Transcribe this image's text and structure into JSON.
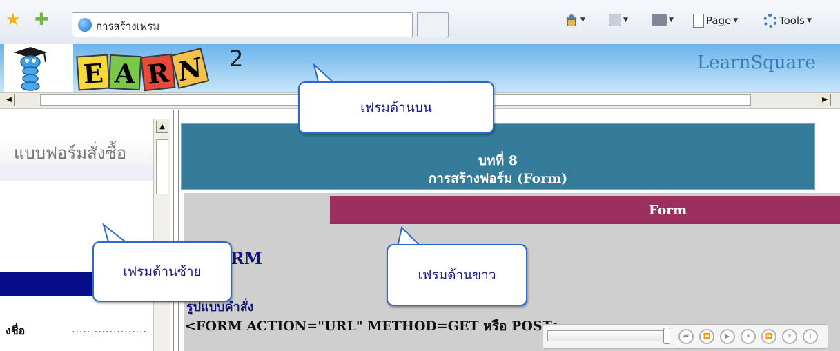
{
  "browser": {
    "tab_title": "การสร้างเฟรม",
    "toolbar": {
      "page_label": "Page",
      "tools_label": "Tools",
      "caret": "▼"
    }
  },
  "banner": {
    "logo_letters": [
      "E",
      "A",
      "R",
      "N"
    ],
    "logo_superscript": "2",
    "site_name": "LearnSquare"
  },
  "left_frame": {
    "title": "แบบฟอร์มสั่งซื้อ",
    "field_label": "งชื่อ",
    "field_placeholder": "...................."
  },
  "right_frame": {
    "chapter_number": "บทที่ 8",
    "chapter_title": "การสร้างฟอร์ม (Form)",
    "form_bar": "Form",
    "heading": "n  FORM",
    "syntax_label": "รูปแบบคำสั่ง",
    "code": "<FORM ACTION=\"URL\" METHOD=GET หรือ POST>"
  },
  "callouts": {
    "top": "เฟรมด้านบน",
    "left": "เฟรมด้านซ้าย",
    "right": "เฟรมด้านขาว"
  },
  "media_player": {
    "buttons": [
      "⏮",
      "⏪",
      "▶",
      "⏸",
      "⏩",
      "✕",
      "i"
    ]
  },
  "colors": {
    "chapter_bg": "#347c9a",
    "form_bar_bg": "#9b2f5d",
    "nav_navy": "#070d8a",
    "callout_border": "#2e68c8"
  }
}
